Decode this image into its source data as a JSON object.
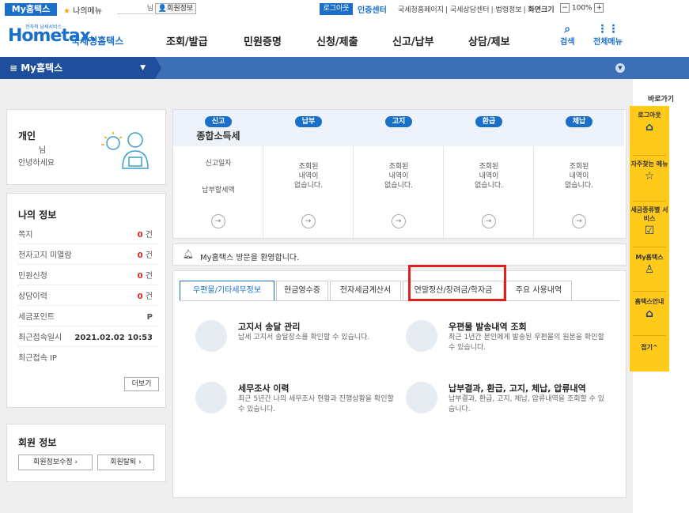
{
  "util": {
    "myhome": "My홈택스",
    "mymenu": "나의메뉴",
    "blank_suffix": "님",
    "member_info": "회원정보",
    "logout": "로그아웃",
    "cert_center": "인증센터",
    "links": [
      "국세청홈페이지",
      "국세상담센터",
      "법령정보",
      "화면크기"
    ],
    "zoom": "100%"
  },
  "header": {
    "logo_small": "전자적 납세서비스",
    "logo_big": "Hometax.",
    "logo_kr": "국세청홈택스",
    "nav": [
      "조회/발급",
      "민원증명",
      "신청/제출",
      "신고/납부",
      "상담/제보"
    ],
    "search": "검색",
    "all_menu": "전체메뉴"
  },
  "bluebar": {
    "title": "≡ My홈택스"
  },
  "profile": {
    "title": "개인",
    "nim": "님",
    "greeting": "안녕하세요"
  },
  "myinfo": {
    "title": "나의 정보",
    "rows": [
      {
        "label": "쪽지",
        "value": "0",
        "unit": " 건"
      },
      {
        "label": "전자고지 미열람",
        "value": "0",
        "unit": " 건"
      },
      {
        "label": "민원신청",
        "value": "0",
        "unit": " 건"
      },
      {
        "label": "상담이력",
        "value": "0",
        "unit": " 건"
      },
      {
        "label": "세금포인트",
        "value": "",
        "unit": "P"
      },
      {
        "label": "최근접속일시",
        "value": "",
        "unit": "2021.02.02 10:53"
      },
      {
        "label": "최근접속 IP",
        "value": "",
        "unit": ""
      }
    ],
    "more": "더보기"
  },
  "member": {
    "title": "회원 정보",
    "edit": "회원정보수정 ›",
    "withdraw": "회원탈퇴 ›"
  },
  "status": {
    "cols": [
      {
        "badge": "신고",
        "sub": "종합소득세",
        "body": [
          "신고일자",
          "",
          "",
          "납부할세액"
        ]
      },
      {
        "badge": "납부",
        "sub": "",
        "body": [
          "조회된",
          "내역이",
          "없습니다."
        ]
      },
      {
        "badge": "고지",
        "sub": "",
        "body": [
          "조회된",
          "내역이",
          "없습니다."
        ]
      },
      {
        "badge": "환급",
        "sub": "",
        "body": [
          "조회된",
          "내역이",
          "없습니다."
        ]
      },
      {
        "badge": "체납",
        "sub": "",
        "body": [
          "조회된",
          "내역이",
          "없습니다."
        ]
      }
    ]
  },
  "welcome": {
    "message": "My홈택스 방문을 환영합니다."
  },
  "tabs": [
    "우편물/기타세무정보",
    "현금영수증",
    "전자세금계산서",
    "연말정산/장려금/학자금",
    "주요 사용내역"
  ],
  "services": [
    {
      "title": "고지서 송달 관리",
      "desc": "납세 고지서 송달장소를 확인할 수 있습니다."
    },
    {
      "title": "우편물 발송내역 조회",
      "desc": "최근 1년간 본인에게 발송된 우편물의 원본을 확인할 수 있습니다."
    },
    {
      "title": "세무조사 이력",
      "desc": "최근 5년간 나의 세무조사 현황과 진행상황을 확인할 수 있습니다."
    },
    {
      "title": "납부결과, 환급, 고지, 체납, 압류내역",
      "desc": "납부결과, 환급, 고지, 체납, 압류내역을 조회할 수 있습니다."
    }
  ],
  "quick": {
    "label": "바로가기",
    "items": [
      "로그아웃",
      "자주찾는 메뉴",
      "세금종류별 서비스",
      "My홈택스",
      "홈택스안내",
      "접기^"
    ]
  },
  "colors": {
    "brand": "#1a6fc9",
    "bar": "#3c6fb6",
    "quick": "#ffca1a",
    "highlight": "#e0201a"
  }
}
